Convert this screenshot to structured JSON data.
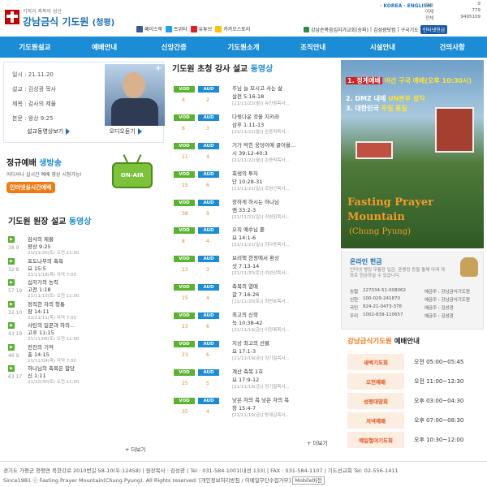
{
  "header": {
    "tagline": "기적과 축복의 성산",
    "site_name": "강남금식 기도원",
    "site_sub": "(청평)",
    "languages": "· KOREA · ENGLISH",
    "counter": [
      {
        "label": "오늘",
        "value": "9"
      },
      {
        "label": "어제",
        "value": "779"
      },
      {
        "label": "전체",
        "value": "9495109"
      }
    ],
    "sns": [
      {
        "label": "페이스북",
        "color": "#3b5998"
      },
      {
        "label": "트위터",
        "color": "#1da1f2"
      },
      {
        "label": "유튜브",
        "color": "#e02020"
      },
      {
        "label": "카카오스토리",
        "color": "#f7c600"
      }
    ],
    "top_links": [
      "강남순복음입자가교회(송파)",
      "김성광닷컴",
      "구국기도"
    ],
    "prayer_button": "인터넷헌금"
  },
  "nav": [
    "기도원설교",
    "예배안내",
    "신앙간증",
    "기도원소개",
    "조직안내",
    "시설안내",
    "건의사항"
  ],
  "pastor": {
    "date": "일시 : 21.11.20",
    "speaker": "설교 : 김성광 목사",
    "title": "제목 : 감사의 제물",
    "passage": "본문 : 왕상 9:25",
    "btn_video": "설교동영상보기",
    "btn_audio": "오디오듣기"
  },
  "live": {
    "title_a": "정규예배",
    "title_b": "생방송",
    "desc": "어디서나 실시간 예배 영상 시청가능!",
    "button": "인터넷실시간예배",
    "tv_label": "ON-AIR"
  },
  "sermons": {
    "title_a": "기도원 원장 설교",
    "title_b": "동영상",
    "items": [
      {
        "count": "38 9",
        "title": "감사의 제물",
        "passage": "왕상 9:25",
        "date": "21/11/20(토) 오전 11:00"
      },
      {
        "count": "32 8",
        "title": "포도나무의 축복",
        "passage": "요 15:5",
        "date": "21/11/18(목) 저녁 7:00"
      },
      {
        "count": "57 19",
        "title": "십자가의 능력",
        "passage": "고전 1:18",
        "date": "21/11/13(토) 오전 11:00"
      },
      {
        "count": "32 10",
        "title": "정직한 자의 형통",
        "passage": "잠 14:11",
        "date": "21/11/11(목) 저녁 7:00"
      },
      {
        "count": "43 19",
        "title": "사탄의 일꾼과 하의...",
        "passage": "고후 11:15",
        "date": "21/11/06(토) 오전 11:00"
      },
      {
        "count": "46 9",
        "title": "전진의 기적",
        "passage": "출 14:15",
        "date": "21/11/04(목) 저녁 7:00"
      },
      {
        "count": "63 17",
        "title": "하나님의 축복은 합당",
        "passage": "신 1:11",
        "date": "21/10/30(토) 오전 11:00"
      }
    ],
    "more": "+ 더보기"
  },
  "lecture": {
    "title_a": "기도원 초청 강사 설교",
    "title_b": "동영상",
    "vod": "VOD",
    "aud": "AUD",
    "items": [
      {
        "vod": "4",
        "aud": "2",
        "l1": "주님 늘 모시고 사는 삶",
        "l2": "살전 5:16-18",
        "l3": "[21/11/22(월)] 유진형목사..."
      },
      {
        "vod": "6",
        "aud": "3",
        "l1": "다윗다운 것을 지키라",
        "l2": "삼후 1:11-13",
        "l3": "[21/11/22(월)] 손증락목사..."
      },
      {
        "vod": "11",
        "aud": "4",
        "l1": "기가 막힌 웅덩이에 끌어올...",
        "l2": "시 39:12-40:3",
        "l3": "[21/11/22(월)] 손증락목사..."
      },
      {
        "vod": "15",
        "aud": "6",
        "l1": "회생의 투자",
        "l2": "단 10:28-31",
        "l3": "[21/11/21(일)] 조원근목사..."
      },
      {
        "vod": "38",
        "aud": "9",
        "l1": "장하게 하시는 하나님",
        "l2": "렘 33:2-3",
        "l3": "[21/11/21(일)] 최영환목사..."
      },
      {
        "vod": "8",
        "aud": "4",
        "l1": "오직 예수님 뿐",
        "l2": "요 14:1-6",
        "l3": "[21/11/21(일)] 최다증목사..."
      },
      {
        "vod": "13",
        "aud": "3",
        "l1": "브리핵 한정에서 환상",
        "l2": "삿 7:13-14",
        "l3": "[21/11/20(토)] 여성상목사..."
      },
      {
        "vod": "15",
        "aud": "4",
        "l1": "축복의 열매",
        "l2": "갈 7:16-26",
        "l3": "[21/11/20(토)] 최연호목사..."
      },
      {
        "vod": "23",
        "aud": "6",
        "l1": "최고의 신학",
        "l2": "눅 10:38-42",
        "l3": "[21/11/19(금)] 이정록목사..."
      },
      {
        "vod": "23",
        "aud": "6",
        "l1": "지상 최고의 선물",
        "l2": "요 17:1-3",
        "l3": "[21/11/19(금)] 정기철목사..."
      },
      {
        "vod": "25",
        "aud": "5",
        "l1": "계산 축복 1호",
        "l2": "요 17:9-12",
        "l3": "[21/11/19(금)] 정기철목사..."
      },
      {
        "vod": "35",
        "aud": "4",
        "l1": "낮은 자의 복 낮은 자의 복",
        "l2": "창 15:4-7",
        "l3": "[21/11/19(금)] 방재길목사..."
      }
    ],
    "more": "+ 더보기"
  },
  "banner": {
    "line1_a": "1. 정계예배",
    "line1_b": "야간 구국 예배(오후 10:30시)",
    "line2_a": "2. DMZ 내에",
    "line2_b": "UN본부 설치",
    "line3_a": "3. 대한민국",
    "line3_b": "주일 통일",
    "fasting": "Fasting Prayer",
    "mountain": "Mountain",
    "chungpyung": "(Chung Pyung)"
  },
  "offering": {
    "title": "온라인 헌금",
    "desc": "인터넷 뱅킹 무통장 입금, 폰뱅킹 등을 통해 아래 계좌로 헌금하실 수 있습니다.",
    "rows": [
      {
        "bank": "농협",
        "account": "227034-51-008062",
        "holder": "예금주 : 강남금식기도원"
      },
      {
        "bank": "신한",
        "account": "100-029-241870",
        "holder": "예금주 : 강남금식기도원"
      },
      {
        "bank": "국민",
        "account": "824-21-0473-378",
        "holder": "예금주 : 김성광"
      },
      {
        "bank": "우리",
        "account": "1002-839-110657",
        "holder": "예금주 : 김성광"
      }
    ]
  },
  "worship": {
    "title_a": "강남금식기도원",
    "title_b": "예배안내",
    "rows": [
      {
        "label": "새벽기도회",
        "time": "오전 05:00~05:45"
      },
      {
        "label": "오전예배",
        "time": "오전 11:00~12:30"
      },
      {
        "label": "성령대망회",
        "time": "오후 03:00~04:30"
      },
      {
        "label": "저녁예배",
        "time": "오후 07:00~08:30"
      },
      {
        "label": "예일철야기도회",
        "time": "오후 10:30~12:00"
      }
    ]
  },
  "footer": {
    "line1": "경기도 가평군 청평면 북한강로 2010번길 58-10(우:12458) | 원장목사 : 김성광 | Tel : 031-584-1001(내선 133) | FAX : 031-584-1107 | 기도선교회 Tel: 02-556-1411",
    "line2": "Since1981 ⓒ Fasting Prayer Mountain(Chung Pyung). All Rights reserved.",
    "privacy": "[개인정보처리방침 / 이메일무단수집거부]",
    "mobile": "Mobile버전"
  }
}
